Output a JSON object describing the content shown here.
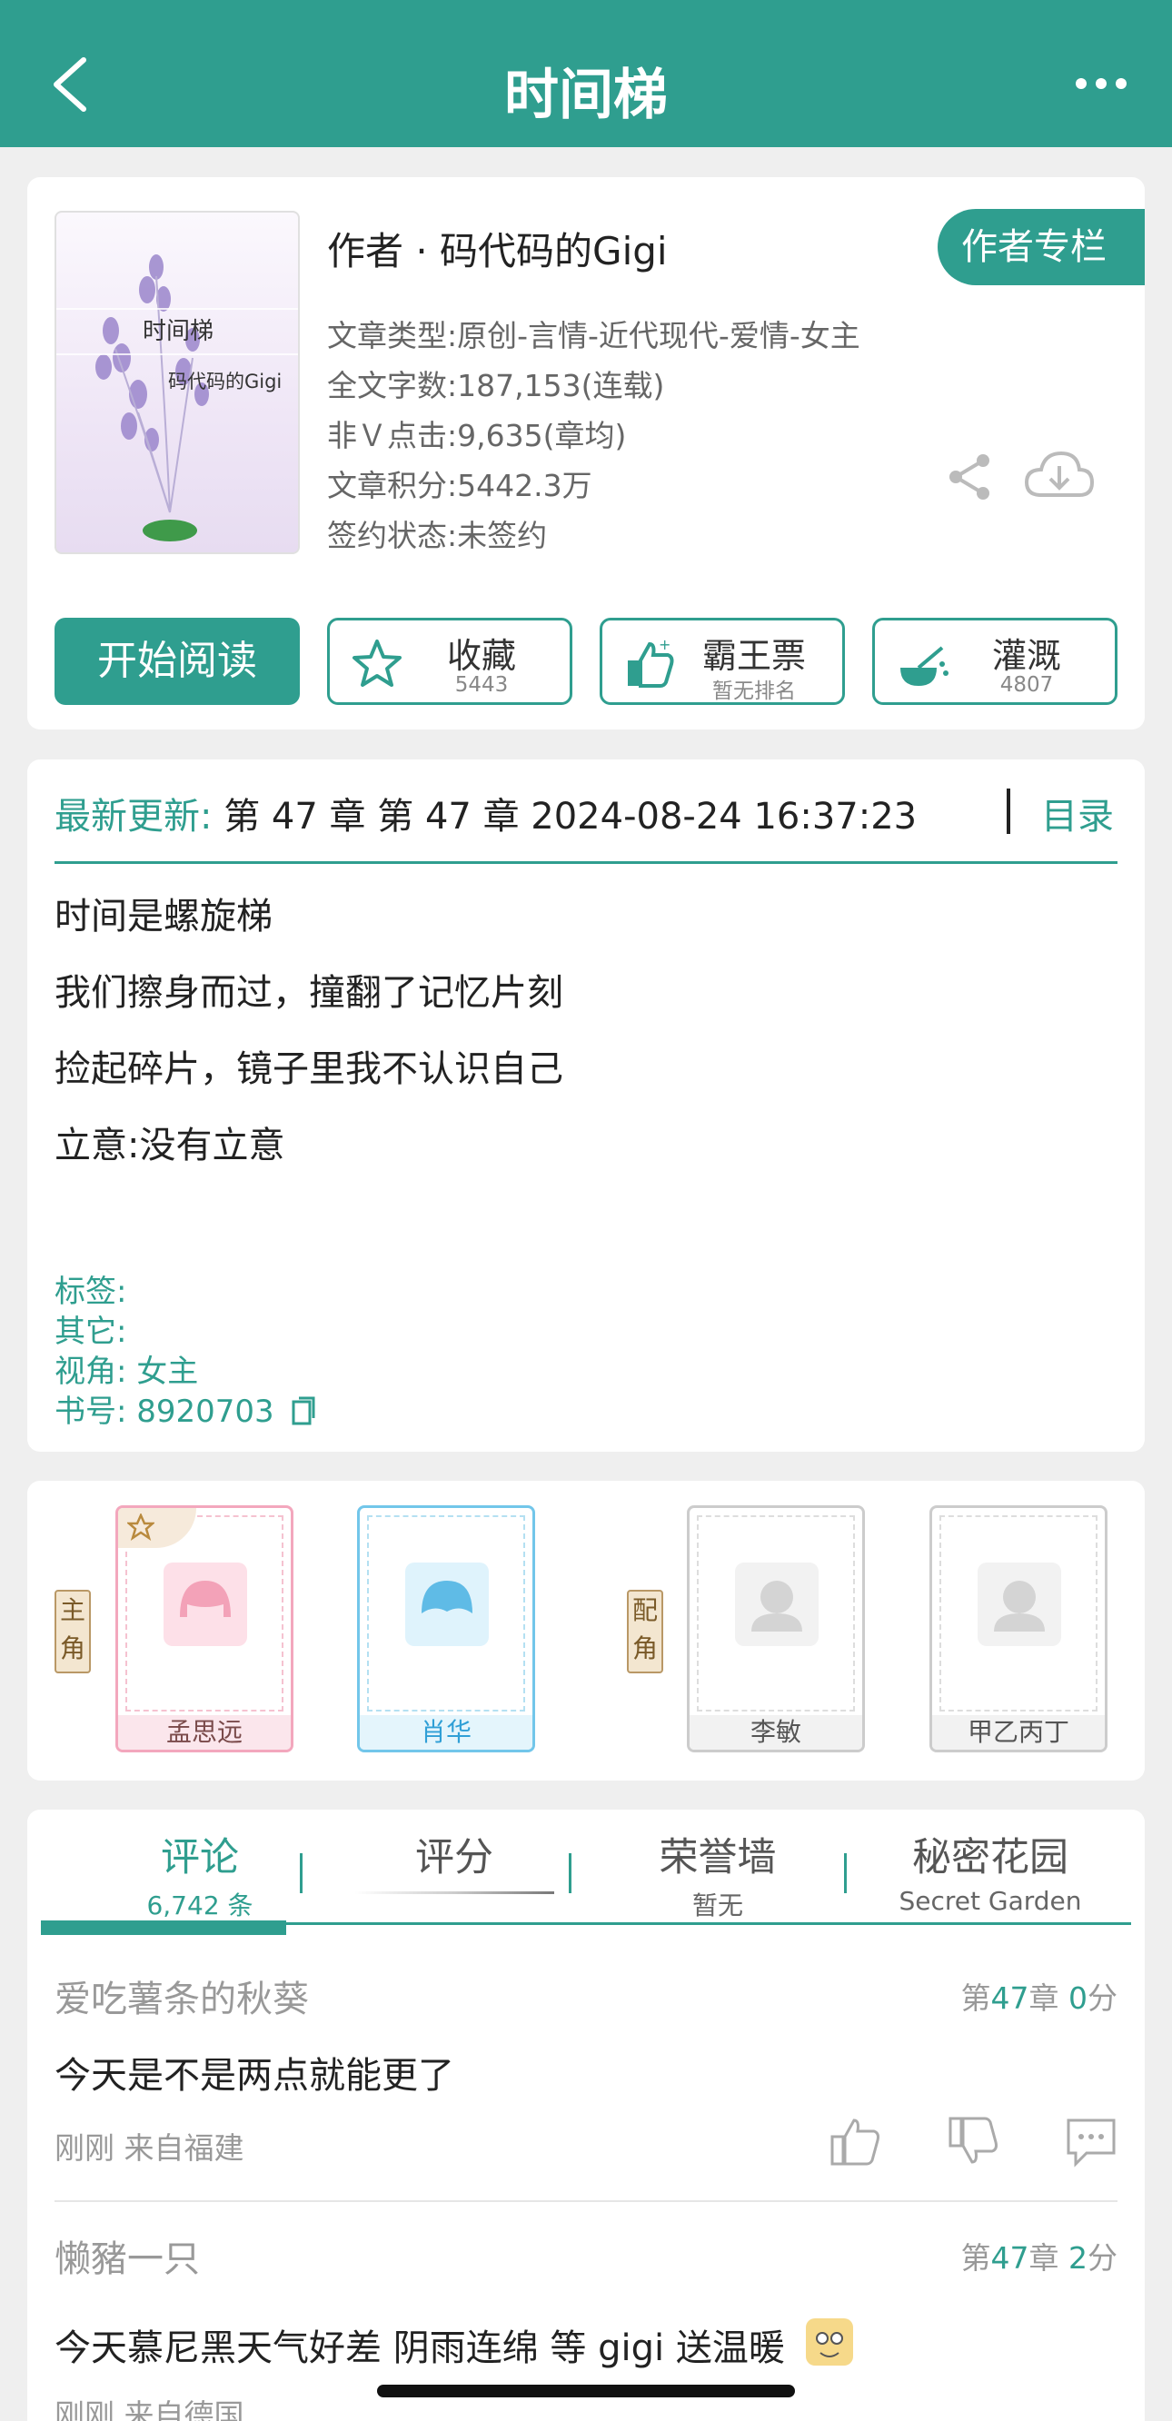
{
  "header": {
    "title": "时间梯"
  },
  "book": {
    "cover_title": "时间梯",
    "cover_author": "码代码的Gigi",
    "author_line": "作者 · 码代码的Gigi",
    "author_column": "作者专栏",
    "info": [
      "文章类型:原创-言情-近代现代-爱情-女主",
      "全文字数:187,153(连载)",
      "非Ｖ点击:9,635(章均)",
      "文章积分:5442.3万",
      "签约状态:未签约"
    ]
  },
  "actions": {
    "read": "开始阅读",
    "collect": {
      "label": "收藏",
      "sub": "5443"
    },
    "ticket": {
      "label": "霸王票",
      "sub": "暂无排名"
    },
    "water": {
      "label": "灌溉",
      "sub": "4807"
    }
  },
  "latest": {
    "key": "最新更新:",
    "value": "第 47 章 第 47 章 2024-08-24 16:37:23",
    "toc": "目录"
  },
  "intro": [
    "时间是螺旋梯",
    "我们擦身而过，撞翻了记忆片刻",
    "捡起碎片，镜子里我不认识自己",
    "立意:没有立意"
  ],
  "meta": {
    "tags": "标签:",
    "other": "其它:",
    "view": "视角:  女主",
    "book_no": "书号:  8920703"
  },
  "roles": {
    "main_tag": "主角",
    "support_tag": "配角",
    "chars": [
      "孟思远",
      "肖华",
      "李敏",
      "甲乙丙丁"
    ]
  },
  "tabs": [
    {
      "label": "评论",
      "sub": "6,742 条"
    },
    {
      "label": "评分",
      "sub": ""
    },
    {
      "label": "荣誉墙",
      "sub": "暂无"
    },
    {
      "label": "秘密花园",
      "sub": "Secret Garden"
    }
  ],
  "comments": [
    {
      "user": "爱吃薯条的秋葵",
      "ch_pre": "第",
      "ch_num": "47",
      "ch_mid": "章",
      "score": "0",
      "score_unit": "分",
      "text": "今天是不是两点就能更了",
      "time": "刚刚  来自福建"
    },
    {
      "user": "懒豬一只",
      "ch_pre": "第",
      "ch_num": "47",
      "ch_mid": "章",
      "score": "2",
      "score_unit": "分",
      "text": "今天慕尼黑天气好差 阴雨连绵 等 gigi 送温暖",
      "time": "刚刚  来自德国"
    }
  ],
  "colors": {
    "accent": "#2f9e8f",
    "background": "#efefef"
  }
}
